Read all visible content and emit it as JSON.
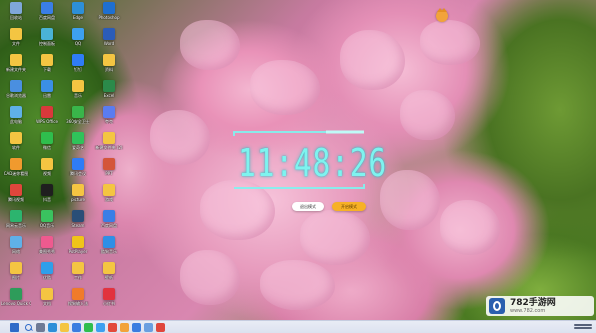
{
  "clock": {
    "time": "11:48:26",
    "buttons": [
      "退出模式",
      "开启模式"
    ]
  },
  "watermark": {
    "text": "782手游网",
    "url": "www.782.com"
  },
  "colors": {
    "clock_digits": "#7ff3ef",
    "accent_button": "#f7b125",
    "taskbar": "#e9ecf5"
  },
  "desktop": {
    "icons": [
      {
        "name": "recycle-bin-icon",
        "label": "回收站",
        "color": "#7fa7d9"
      },
      {
        "name": "folder-icon",
        "label": "文件",
        "color": "#f4c542"
      },
      {
        "name": "folder-icon",
        "label": "新建文件夹",
        "color": "#f4c542"
      },
      {
        "name": "app-icon",
        "label": "谷歌浏览器",
        "color": "#4a8fe0"
      },
      {
        "name": "this-pc-icon",
        "label": "此电脑",
        "color": "#5fb0e8"
      },
      {
        "name": "folder-icon",
        "label": "软件",
        "color": "#f4c542"
      },
      {
        "name": "app-icon",
        "label": "CAD迷你看图",
        "color": "#f09a2e"
      },
      {
        "name": "app-icon",
        "label": "腾讯视频",
        "color": "#e0463c"
      },
      {
        "name": "app-icon",
        "label": "网易云音乐",
        "color": "#2cb46e"
      },
      {
        "name": "network-icon",
        "label": "网络",
        "color": "#5fb0e8"
      },
      {
        "name": "folder-icon",
        "label": "图片",
        "color": "#f4c542"
      },
      {
        "name": "app-icon",
        "label": "Lenovo Quick Clean",
        "color": "#2e9c5a"
      },
      {
        "name": "app-icon",
        "label": "百度网盘",
        "color": "#3a7ee6"
      },
      {
        "name": "control-panel-icon",
        "label": "控制面板",
        "color": "#4ab3d6"
      },
      {
        "name": "folder-icon",
        "label": "下载",
        "color": "#f4c542"
      },
      {
        "name": "app-icon",
        "label": "迅雷",
        "color": "#3b8fe5"
      },
      {
        "name": "app-icon",
        "label": "WPS Office",
        "color": "#d9383b"
      },
      {
        "name": "app-icon",
        "label": "微信",
        "color": "#2fbe4d"
      },
      {
        "name": "folder-icon",
        "label": "视频",
        "color": "#f4c542"
      },
      {
        "name": "app-icon",
        "label": "抖音",
        "color": "#1f1f1f"
      },
      {
        "name": "app-icon",
        "label": "QQ音乐",
        "color": "#3ac25f"
      },
      {
        "name": "app-icon",
        "label": "美图秀秀",
        "color": "#ef5a8f"
      },
      {
        "name": "app-icon",
        "label": "优酷",
        "color": "#2f9fea"
      },
      {
        "name": "folder-icon",
        "label": "文档",
        "color": "#f4c542"
      },
      {
        "name": "app-icon",
        "label": "Edge",
        "color": "#2d8fd8"
      },
      {
        "name": "app-icon",
        "label": "QQ",
        "color": "#3da0f0"
      },
      {
        "name": "app-icon",
        "label": "钉钉",
        "color": "#2f7cf6"
      },
      {
        "name": "folder-icon",
        "label": "音乐",
        "color": "#f4c542"
      },
      {
        "name": "app-icon",
        "label": "360安全卫士",
        "color": "#39b54a"
      },
      {
        "name": "app-icon",
        "label": "爱奇艺",
        "color": "#2fc35a"
      },
      {
        "name": "app-icon",
        "label": "腾讯会议",
        "color": "#2f7cf6"
      },
      {
        "name": "folder-icon",
        "label": "picture",
        "color": "#f4c542"
      },
      {
        "name": "app-icon",
        "label": "Steam",
        "color": "#2a4e77"
      },
      {
        "name": "app-icon",
        "label": "PotPlayer",
        "color": "#f0c419"
      },
      {
        "name": "folder-icon",
        "label": "工作",
        "color": "#f4c542"
      },
      {
        "name": "app-icon",
        "label": "搜狗输入法",
        "color": "#f07b2a"
      },
      {
        "name": "app-icon",
        "label": "Photoshop",
        "color": "#1e6fd1"
      },
      {
        "name": "app-icon",
        "label": "Word",
        "color": "#2b5cb8"
      },
      {
        "name": "folder-icon",
        "label": "资料",
        "color": "#f4c542"
      },
      {
        "name": "app-icon",
        "label": "Excel",
        "color": "#2b8a4a"
      },
      {
        "name": "app-icon",
        "label": "夸克",
        "color": "#5a7cf0"
      },
      {
        "name": "folder-icon",
        "label": "新建文件夹 (2)",
        "color": "#f4c542"
      },
      {
        "name": "app-icon",
        "label": "PPT",
        "color": "#d4553a"
      },
      {
        "name": "folder-icon",
        "label": "游戏",
        "color": "#f4c542"
      },
      {
        "name": "app-icon",
        "label": "百度网盘",
        "color": "#3a7ee6"
      },
      {
        "name": "app-icon",
        "label": "酷狗音乐",
        "color": "#2f8fe6"
      },
      {
        "name": "folder-icon",
        "label": "壁纸",
        "color": "#f4c542"
      },
      {
        "name": "app-icon",
        "label": "小红书",
        "color": "#e2323e"
      }
    ]
  },
  "taskbar": {
    "items": [
      {
        "name": "start-icon",
        "color": "#2e6ac8"
      },
      {
        "name": "search-icon",
        "color": "#2e6ac8"
      },
      {
        "name": "task-view-icon",
        "color": "#6e7a95"
      },
      {
        "name": "edge-icon",
        "color": "#2d8fd8"
      },
      {
        "name": "file-explorer-icon",
        "color": "#f4c542"
      },
      {
        "name": "store-icon",
        "color": "#3b7de0"
      },
      {
        "name": "wechat-icon",
        "color": "#2fbe4d"
      },
      {
        "name": "qq-icon",
        "color": "#3da0f0"
      },
      {
        "name": "chrome-icon",
        "color": "#e24a3b"
      },
      {
        "name": "fox-app-icon",
        "color": "#f2a33a"
      },
      {
        "name": "mail-icon",
        "color": "#3b7de0"
      },
      {
        "name": "photos-icon",
        "color": "#6a9fe0"
      },
      {
        "name": "music-icon",
        "color": "#e0463c"
      }
    ]
  }
}
